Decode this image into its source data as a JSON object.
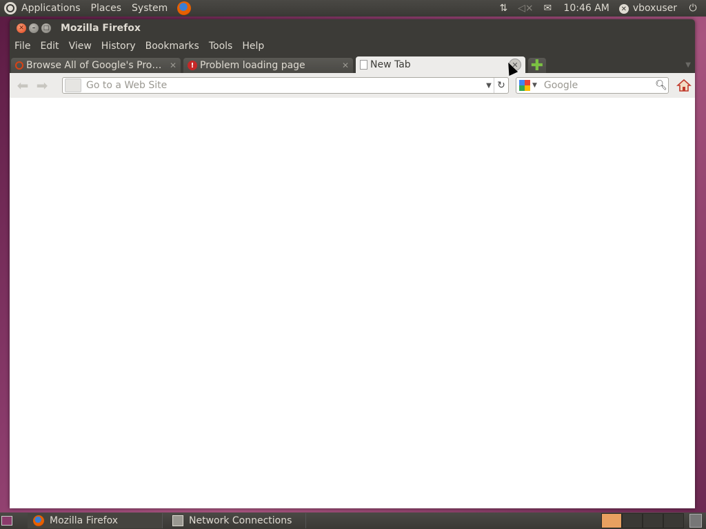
{
  "top_panel": {
    "menus": [
      "Applications",
      "Places",
      "System"
    ],
    "time": "10:46 AM",
    "user": "vboxuser"
  },
  "window": {
    "title": "Mozilla Firefox",
    "menubar": [
      "File",
      "Edit",
      "View",
      "History",
      "Bookmarks",
      "Tools",
      "Help"
    ]
  },
  "tabs": [
    {
      "label": "Browse All of Google's Pro…",
      "icon": "opera-circle-icon"
    },
    {
      "label": "Problem loading page",
      "icon": "error-icon"
    },
    {
      "label": "New Tab",
      "icon": "blank-page-icon",
      "active": true
    }
  ],
  "navbar": {
    "url_placeholder": "Go to a Web Site",
    "url_value": "",
    "search_placeholder": "Google"
  },
  "taskbar": {
    "items": [
      "Mozilla Firefox",
      "Network Connections"
    ]
  },
  "colors": {
    "panel": "#3c3b37",
    "accent_orange": "#e0431a",
    "newtab_green": "#7bc142"
  }
}
